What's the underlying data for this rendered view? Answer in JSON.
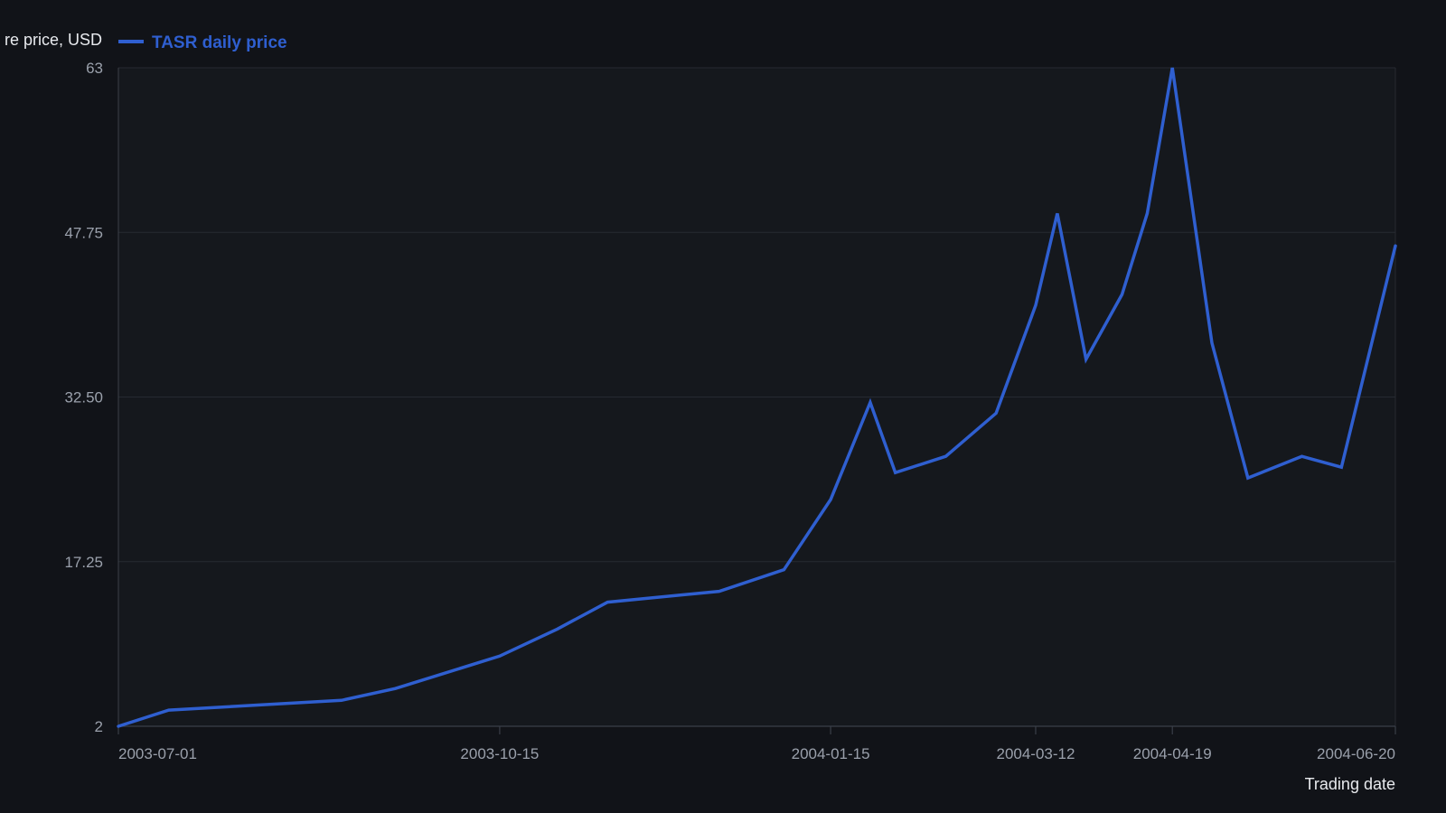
{
  "colors": {
    "background": "#111318",
    "plot_background": "#15181d",
    "grid": "#262a31",
    "axis": "#3a3f48",
    "series": "#2f5fd0"
  },
  "chart_data": {
    "type": "line",
    "title": "",
    "xlabel": "Trading date",
    "ylabel": "re price, USD",
    "x_axis_type": "date",
    "xlim": [
      "2003-07-01",
      "2004-06-20"
    ],
    "ylim": [
      2,
      63
    ],
    "yticks": [
      2,
      17.25,
      32.5,
      47.75,
      63
    ],
    "ytick_labels": [
      "2",
      "17.25",
      "32.50",
      "47.75",
      "63"
    ],
    "xticks": [
      "2003-07-01",
      "2003-10-15",
      "2004-01-15",
      "2004-03-12",
      "2004-04-19",
      "2004-06-20"
    ],
    "xtick_labels": [
      "2003-07-01",
      "2003-10-15",
      "2004-01-15",
      "2004-03-12",
      "2004-04-19",
      "2004-06-20"
    ],
    "grid": true,
    "legend_position": "top-left",
    "series": [
      {
        "name": "TASR daily price",
        "color": "#2f5fd0",
        "points": [
          {
            "x": "2003-07-01",
            "y": 2.0
          },
          {
            "x": "2003-07-15",
            "y": 3.5
          },
          {
            "x": "2003-09-01",
            "y": 4.4
          },
          {
            "x": "2003-09-16",
            "y": 5.5
          },
          {
            "x": "2003-10-15",
            "y": 8.5
          },
          {
            "x": "2003-10-31",
            "y": 11.0
          },
          {
            "x": "2003-11-14",
            "y": 13.5
          },
          {
            "x": "2003-12-15",
            "y": 14.5
          },
          {
            "x": "2004-01-02",
            "y": 16.5
          },
          {
            "x": "2004-01-15",
            "y": 23.0
          },
          {
            "x": "2004-01-26",
            "y": 32.0
          },
          {
            "x": "2004-02-02",
            "y": 25.5
          },
          {
            "x": "2004-02-16",
            "y": 27.0
          },
          {
            "x": "2004-03-01",
            "y": 31.0
          },
          {
            "x": "2004-03-12",
            "y": 41.0
          },
          {
            "x": "2004-03-18",
            "y": 49.5
          },
          {
            "x": "2004-03-26",
            "y": 36.0
          },
          {
            "x": "2004-04-05",
            "y": 42.0
          },
          {
            "x": "2004-04-12",
            "y": 49.5
          },
          {
            "x": "2004-04-19",
            "y": 63.0
          },
          {
            "x": "2004-04-30",
            "y": 37.5
          },
          {
            "x": "2004-05-10",
            "y": 25.0
          },
          {
            "x": "2004-05-25",
            "y": 27.0
          },
          {
            "x": "2004-06-05",
            "y": 26.0
          },
          {
            "x": "2004-06-20",
            "y": 46.5
          }
        ]
      }
    ]
  }
}
